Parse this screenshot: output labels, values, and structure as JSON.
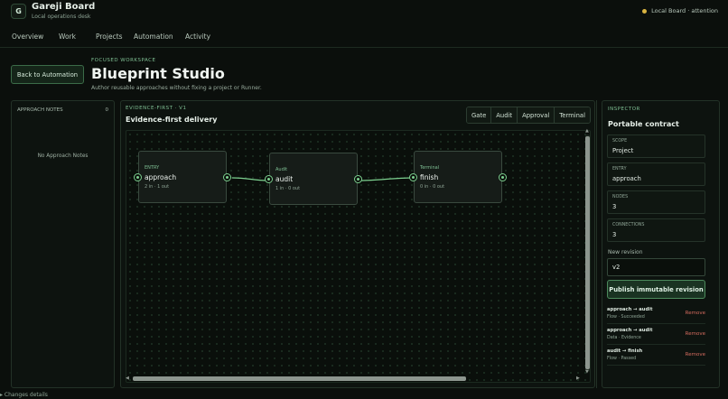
{
  "app": {
    "logo_letter": "G",
    "title": "Gareji Board",
    "subtitle": "Local operations desk"
  },
  "status": {
    "text": "Local Board · attention",
    "color": "#d9b441"
  },
  "nav": [
    "Overview",
    "Work",
    "Projects",
    "Automation",
    "Activity"
  ],
  "header": {
    "back_label": "Back to Automation",
    "eyebrow": "FOCUSED WORKSPACE",
    "title": "Blueprint Studio",
    "subtitle": "Author reusable approaches without fixing a project or Runner."
  },
  "notes": {
    "heading": "APPROACH NOTES",
    "count": "0",
    "empty": "No Approach Notes"
  },
  "blueprint": {
    "eyebrow": "EVIDENCE-FIRST · V1",
    "title": "Evidence-first delivery",
    "tools": [
      "Gate",
      "Audit",
      "Approval",
      "Terminal"
    ],
    "nodes": [
      {
        "kind": "ENTRY",
        "name": "approach",
        "meta": "2 in · 1 out"
      },
      {
        "kind": "Audit",
        "name": "audit",
        "meta": "1 in · 0 out"
      },
      {
        "kind": "Terminal",
        "name": "finish",
        "meta": "0 in · 0 out"
      }
    ]
  },
  "inspector": {
    "eyebrow": "INSPECTOR",
    "title": "Portable contract",
    "fields": [
      {
        "label": "SCOPE",
        "value": "Project"
      },
      {
        "label": "ENTRY",
        "value": "approach"
      },
      {
        "label": "NODES",
        "value": "3"
      },
      {
        "label": "CONNECTIONS",
        "value": "3"
      }
    ],
    "revision_label": "New revision",
    "revision_value": "v2",
    "publish_label": "Publish immutable revision",
    "connections": [
      {
        "title": "approach → audit",
        "detail": "Flow · Succeeded",
        "remove": "Remove"
      },
      {
        "title": "approach → audit",
        "detail": "Data · Evidence",
        "remove": "Remove"
      },
      {
        "title": "audit → finish",
        "detail": "Flow · Passed",
        "remove": "Remove"
      }
    ]
  },
  "footer": {
    "text": "▸ Changes details"
  },
  "colors": {
    "accent": "#7cd08f",
    "background": "#0b0f0c",
    "danger": "#d36b5e"
  }
}
